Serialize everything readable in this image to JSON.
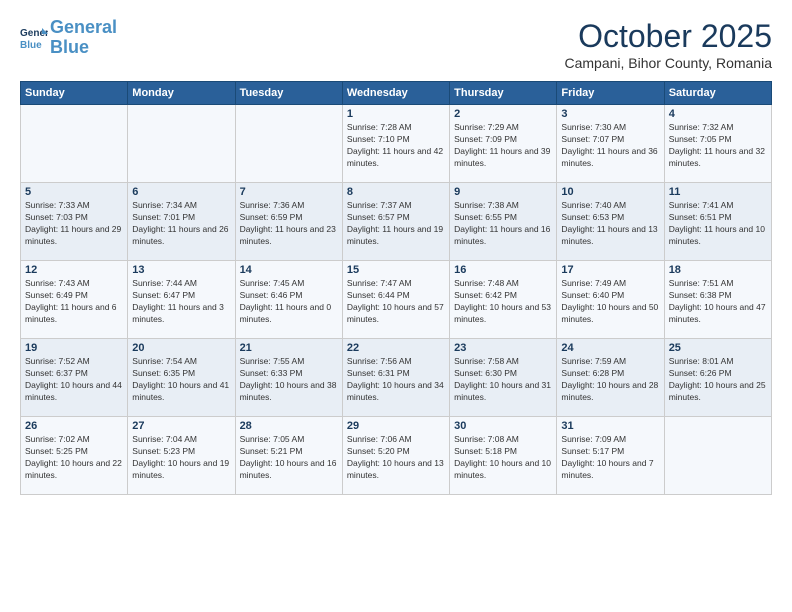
{
  "header": {
    "logo_line1": "General",
    "logo_line2": "Blue",
    "month": "October 2025",
    "location": "Campani, Bihor County, Romania"
  },
  "days_of_week": [
    "Sunday",
    "Monday",
    "Tuesday",
    "Wednesday",
    "Thursday",
    "Friday",
    "Saturday"
  ],
  "weeks": [
    [
      {
        "num": "",
        "info": ""
      },
      {
        "num": "",
        "info": ""
      },
      {
        "num": "",
        "info": ""
      },
      {
        "num": "1",
        "info": "Sunrise: 7:28 AM\nSunset: 7:10 PM\nDaylight: 11 hours and 42 minutes."
      },
      {
        "num": "2",
        "info": "Sunrise: 7:29 AM\nSunset: 7:09 PM\nDaylight: 11 hours and 39 minutes."
      },
      {
        "num": "3",
        "info": "Sunrise: 7:30 AM\nSunset: 7:07 PM\nDaylight: 11 hours and 36 minutes."
      },
      {
        "num": "4",
        "info": "Sunrise: 7:32 AM\nSunset: 7:05 PM\nDaylight: 11 hours and 32 minutes."
      }
    ],
    [
      {
        "num": "5",
        "info": "Sunrise: 7:33 AM\nSunset: 7:03 PM\nDaylight: 11 hours and 29 minutes."
      },
      {
        "num": "6",
        "info": "Sunrise: 7:34 AM\nSunset: 7:01 PM\nDaylight: 11 hours and 26 minutes."
      },
      {
        "num": "7",
        "info": "Sunrise: 7:36 AM\nSunset: 6:59 PM\nDaylight: 11 hours and 23 minutes."
      },
      {
        "num": "8",
        "info": "Sunrise: 7:37 AM\nSunset: 6:57 PM\nDaylight: 11 hours and 19 minutes."
      },
      {
        "num": "9",
        "info": "Sunrise: 7:38 AM\nSunset: 6:55 PM\nDaylight: 11 hours and 16 minutes."
      },
      {
        "num": "10",
        "info": "Sunrise: 7:40 AM\nSunset: 6:53 PM\nDaylight: 11 hours and 13 minutes."
      },
      {
        "num": "11",
        "info": "Sunrise: 7:41 AM\nSunset: 6:51 PM\nDaylight: 11 hours and 10 minutes."
      }
    ],
    [
      {
        "num": "12",
        "info": "Sunrise: 7:43 AM\nSunset: 6:49 PM\nDaylight: 11 hours and 6 minutes."
      },
      {
        "num": "13",
        "info": "Sunrise: 7:44 AM\nSunset: 6:47 PM\nDaylight: 11 hours and 3 minutes."
      },
      {
        "num": "14",
        "info": "Sunrise: 7:45 AM\nSunset: 6:46 PM\nDaylight: 11 hours and 0 minutes."
      },
      {
        "num": "15",
        "info": "Sunrise: 7:47 AM\nSunset: 6:44 PM\nDaylight: 10 hours and 57 minutes."
      },
      {
        "num": "16",
        "info": "Sunrise: 7:48 AM\nSunset: 6:42 PM\nDaylight: 10 hours and 53 minutes."
      },
      {
        "num": "17",
        "info": "Sunrise: 7:49 AM\nSunset: 6:40 PM\nDaylight: 10 hours and 50 minutes."
      },
      {
        "num": "18",
        "info": "Sunrise: 7:51 AM\nSunset: 6:38 PM\nDaylight: 10 hours and 47 minutes."
      }
    ],
    [
      {
        "num": "19",
        "info": "Sunrise: 7:52 AM\nSunset: 6:37 PM\nDaylight: 10 hours and 44 minutes."
      },
      {
        "num": "20",
        "info": "Sunrise: 7:54 AM\nSunset: 6:35 PM\nDaylight: 10 hours and 41 minutes."
      },
      {
        "num": "21",
        "info": "Sunrise: 7:55 AM\nSunset: 6:33 PM\nDaylight: 10 hours and 38 minutes."
      },
      {
        "num": "22",
        "info": "Sunrise: 7:56 AM\nSunset: 6:31 PM\nDaylight: 10 hours and 34 minutes."
      },
      {
        "num": "23",
        "info": "Sunrise: 7:58 AM\nSunset: 6:30 PM\nDaylight: 10 hours and 31 minutes."
      },
      {
        "num": "24",
        "info": "Sunrise: 7:59 AM\nSunset: 6:28 PM\nDaylight: 10 hours and 28 minutes."
      },
      {
        "num": "25",
        "info": "Sunrise: 8:01 AM\nSunset: 6:26 PM\nDaylight: 10 hours and 25 minutes."
      }
    ],
    [
      {
        "num": "26",
        "info": "Sunrise: 7:02 AM\nSunset: 5:25 PM\nDaylight: 10 hours and 22 minutes."
      },
      {
        "num": "27",
        "info": "Sunrise: 7:04 AM\nSunset: 5:23 PM\nDaylight: 10 hours and 19 minutes."
      },
      {
        "num": "28",
        "info": "Sunrise: 7:05 AM\nSunset: 5:21 PM\nDaylight: 10 hours and 16 minutes."
      },
      {
        "num": "29",
        "info": "Sunrise: 7:06 AM\nSunset: 5:20 PM\nDaylight: 10 hours and 13 minutes."
      },
      {
        "num": "30",
        "info": "Sunrise: 7:08 AM\nSunset: 5:18 PM\nDaylight: 10 hours and 10 minutes."
      },
      {
        "num": "31",
        "info": "Sunrise: 7:09 AM\nSunset: 5:17 PM\nDaylight: 10 hours and 7 minutes."
      },
      {
        "num": "",
        "info": ""
      }
    ]
  ]
}
